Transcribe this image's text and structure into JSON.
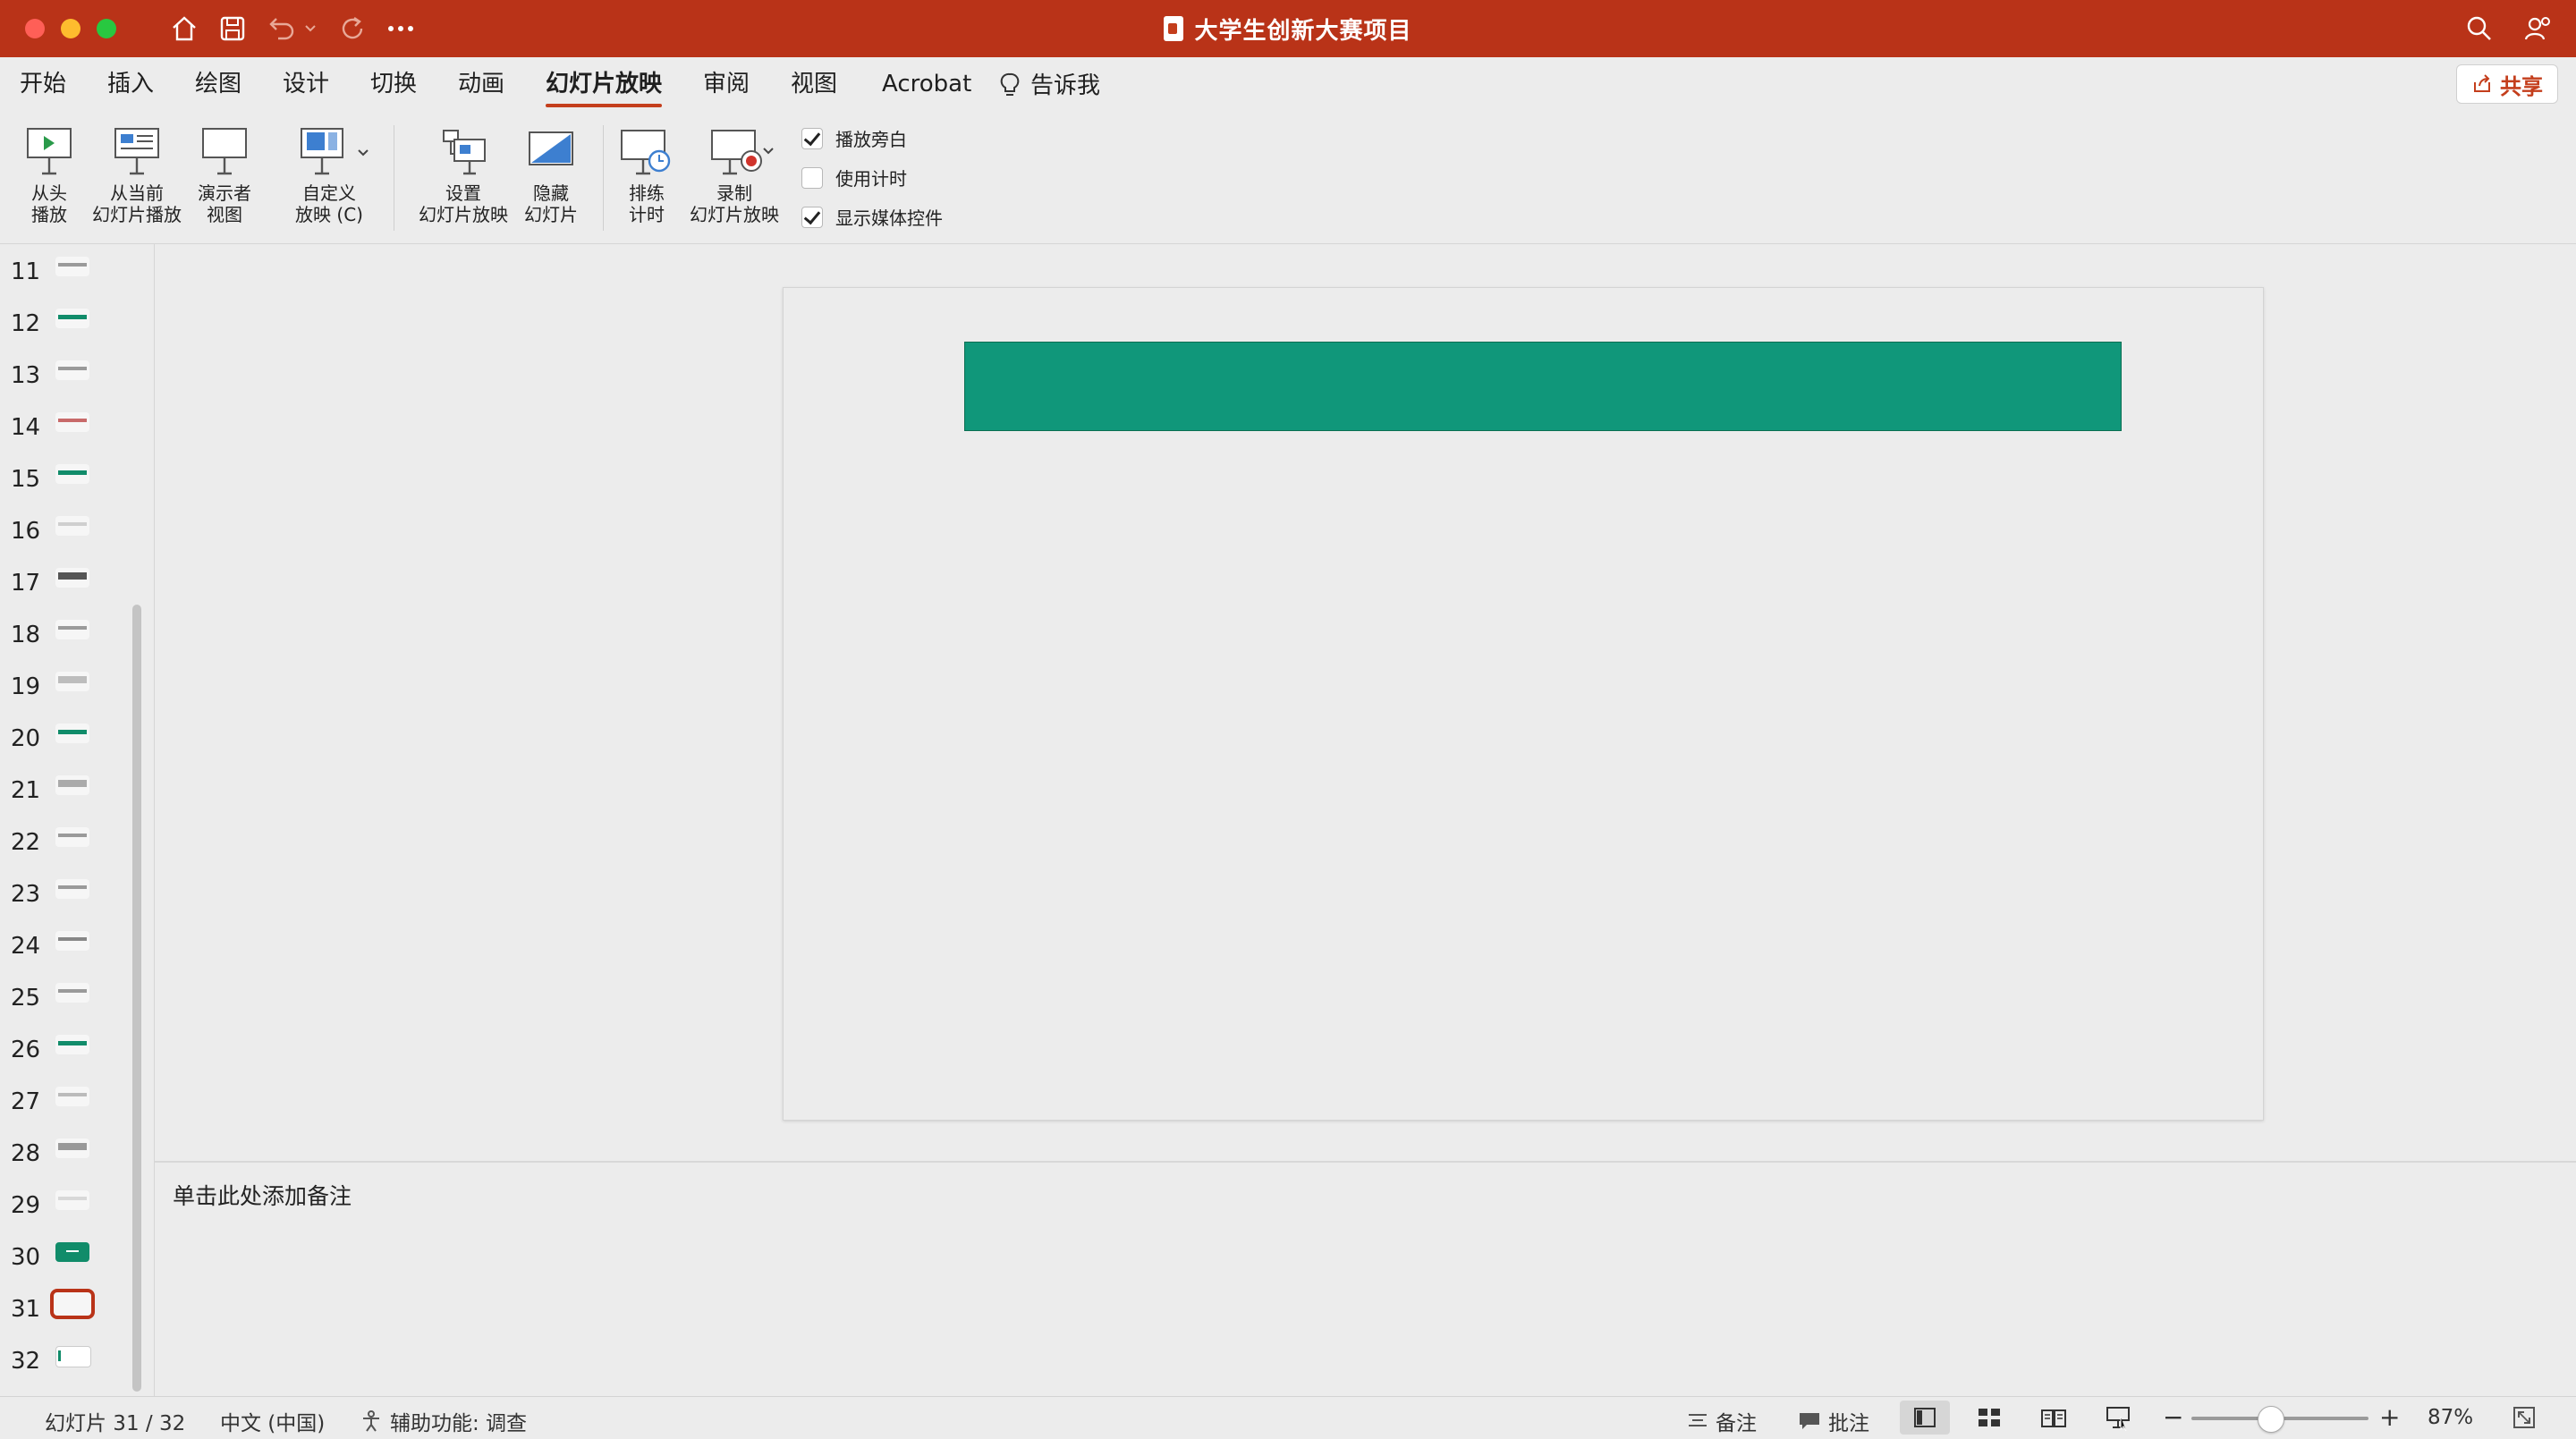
{
  "window": {
    "title": "大学生创新大赛项目"
  },
  "menu": {
    "tabs": [
      "开始",
      "插入",
      "绘图",
      "设计",
      "切换",
      "动画",
      "幻灯片放映",
      "审阅",
      "视图",
      "Acrobat",
      "告诉我"
    ],
    "active_tab": "幻灯片放映",
    "share_label": "共享"
  },
  "ribbon": {
    "buttons": [
      {
        "label": "从头\n播放"
      },
      {
        "label": "从当前\n幻灯片播放"
      },
      {
        "label": "演示者\n视图"
      },
      {
        "label": "自定义\n放映 (C)"
      },
      {
        "label": "设置\n幻灯片放映"
      },
      {
        "label": "隐藏\n幻灯片"
      },
      {
        "label": "排练\n计时"
      },
      {
        "label": "录制\n幻灯片放映"
      }
    ],
    "checkboxes": [
      {
        "label": "播放旁白",
        "checked": true
      },
      {
        "label": "使用计时",
        "checked": false
      },
      {
        "label": "显示媒体控件",
        "checked": true
      }
    ]
  },
  "thumbnails": {
    "numbers": [
      "11",
      "12",
      "13",
      "14",
      "15",
      "16",
      "17",
      "18",
      "19",
      "20",
      "21",
      "22",
      "23",
      "24",
      "25",
      "26",
      "27",
      "28",
      "29",
      "30",
      "31",
      "32"
    ],
    "selected": "31"
  },
  "slide": {
    "bar_color": "#10977a"
  },
  "notes": {
    "placeholder": "单击此处添加备注"
  },
  "status": {
    "slide_counter": "幻灯片 31 / 32",
    "language": "中文 (中国)",
    "accessibility": "辅助功能: 调查",
    "notes_label": "备注",
    "comments_label": "批注",
    "zoom": "87%"
  },
  "colors": {
    "accent": "#b93318",
    "titlebar": "#b93318",
    "slide_bar": "#10977a"
  }
}
